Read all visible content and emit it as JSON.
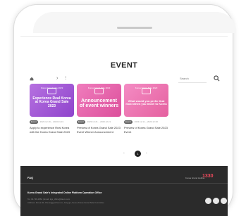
{
  "page": {
    "title": "EVENT"
  },
  "toolbar": {
    "crumb_arrow": "›",
    "crumb_dots": "⁝",
    "search_placeholder": "Search",
    "icons": [
      "home-icon",
      "search-icon"
    ]
  },
  "cards": [
    {
      "thumb_small": "Korea Grand Sale 2023",
      "thumb_text": "Experience Real Korea at Korea Grand Sale 2023",
      "badge": "Event",
      "date": "2023.12.19 ~ 2023.01.31",
      "caption": "Apply to experience Real Korea with the Korea Grand Sale 2023",
      "color": "#a45bd8"
    },
    {
      "thumb_small": "Korea Grand Sale 2023",
      "thumb_text": "Announcement of event winners",
      "badge": "Event",
      "date": "2023.12.21 ~ 2023.12.21",
      "caption": "Preview of Korea Grand Sale 2023 Event Winner Announcement",
      "color": "#e862ab"
    },
    {
      "thumb_small": "Korea Grand Sale 2023",
      "thumb_text": "What would you prefer that most when you travel to Korea",
      "badge": "Event",
      "date": "2023.12.11 ~ 2023.12.30",
      "caption": "Preview of Korea Grand Sale 2023 Event",
      "color": "#ef76b5"
    }
  ],
  "pagination": {
    "prev": "‹",
    "current": "1",
    "next": "›"
  },
  "footer": {
    "faq": "FAQ",
    "call_center_label": "Korea Grand Hotline",
    "call_center_number": "1330",
    "org_name": "Korea Grand Sale's Integrated Online Platform Operation Office",
    "address_line1": "Tel. 02-739-1862  |  Email. kgs_office@daum.com",
    "address_line2": "Address. Korea 40, Cheonggyecheon-ro, Jung-gu, Seoul, Korea Grand Sale Committee",
    "social_icons": [
      "facebook-icon",
      "instagram-icon",
      "youtube-icon"
    ]
  },
  "colors": {
    "footer_bg": "#2b2b2b",
    "accent": "#f04a5c"
  }
}
